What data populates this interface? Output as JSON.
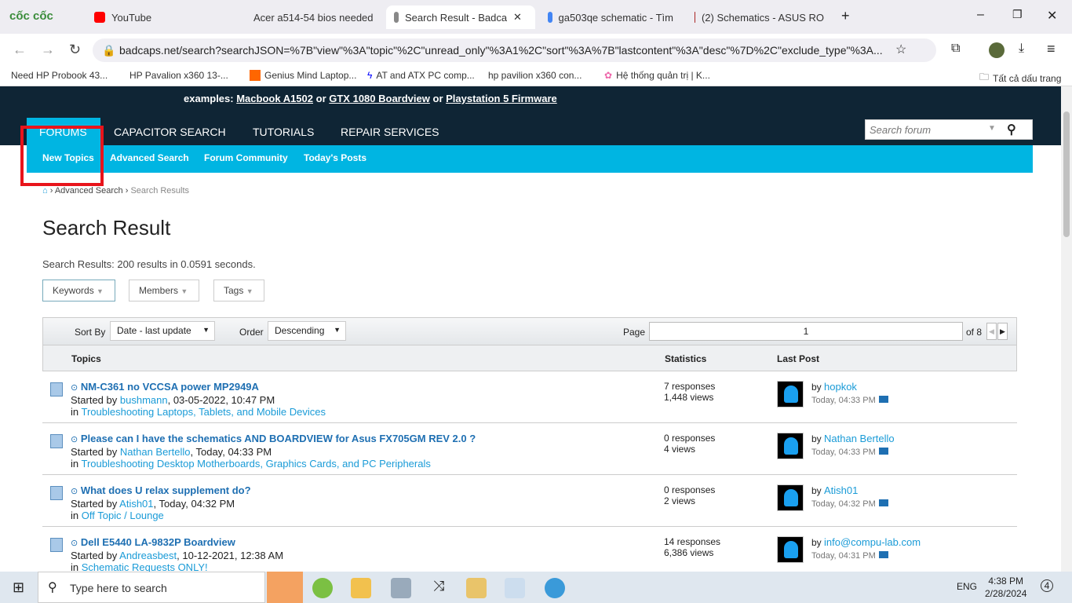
{
  "browser": {
    "brand": "cốc cốc",
    "tabs": [
      {
        "label": "YouTube"
      },
      {
        "label": "Acer a514-54 bios needed"
      },
      {
        "label": "Search Result - Badcaps"
      },
      {
        "label": "ga503qe schematic - Tìm"
      },
      {
        "label": "(2) Schematics - ASUS RO"
      }
    ],
    "url": "badcaps.net/search?searchJSON=%7B\"view\"%3A\"topic\"%2C\"unread_only\"%3A1%2C\"sort\"%3A%7B\"lastcontent\"%3A\"desc\"%7D%2C\"exclude_type\"%3A...",
    "bookmarks": [
      "Need HP Probook 43...",
      "HP Pavalion x360 13-...",
      "Genius Mind Laptop...",
      "AT and ATX PC comp...",
      "hp pavilion x360 con...",
      "Hệ thống quản trị | K..."
    ],
    "all_bookmarks": "Tất cả dấu trang"
  },
  "header": {
    "examples_label": "examples:",
    "ex1": "Macbook A1502",
    "or1": "or",
    "ex2": "GTX 1080 Boardview",
    "or2": "or",
    "ex3": "Playstation 5 Firmware",
    "nav": [
      "FORUMS",
      "CAPACITOR SEARCH",
      "TUTORIALS",
      "REPAIR SERVICES"
    ],
    "search_placeholder": "Search forum",
    "subnav": [
      "New Topics",
      "Advanced Search",
      "Forum Community",
      "Today's Posts"
    ]
  },
  "breadcrumb": [
    "Advanced Search",
    "Search Results"
  ],
  "page_title": "Search Result",
  "summary": "Search Results: 200 results in 0.0591 seconds.",
  "filters": [
    "Keywords",
    "Members",
    "Tags"
  ],
  "toolbar": {
    "sort_label": "Sort By",
    "sort_value": "Date - last update",
    "order_label": "Order",
    "order_value": "Descending",
    "page_label": "Page",
    "page_value": "1",
    "of_label": "of 8"
  },
  "columns": [
    "Topics",
    "Statistics",
    "Last Post"
  ],
  "rows": [
    {
      "title": "NM-C361 no VCCSA power MP2949A",
      "started": "Started by ",
      "author": "bushmann",
      "date": ", 03-05-2022, 10:47 PM",
      "in": "in ",
      "forum": "Troubleshooting Laptops, Tablets, and Mobile Devices",
      "responses": "7 responses",
      "views": "1,448 views",
      "by": "by ",
      "last_user": "hopkok",
      "last_time": "Today, 04:33 PM"
    },
    {
      "title": "Please can I have the schematics AND BOARDVIEW for Asus FX705GM REV 2.0 ?",
      "started": "Started by ",
      "author": "Nathan Bertello",
      "date": ", Today, 04:33 PM",
      "in": "in ",
      "forum": "Troubleshooting Desktop Motherboards, Graphics Cards, and PC Peripherals",
      "responses": "0 responses",
      "views": "4 views",
      "by": "by ",
      "last_user": "Nathan Bertello",
      "last_time": "Today, 04:33 PM"
    },
    {
      "title": "What does U relax supplement do?",
      "started": "Started by ",
      "author": "Atish01",
      "date": ", Today, 04:32 PM",
      "in": "in ",
      "forum": "Off Topic / Lounge",
      "responses": "0 responses",
      "views": "2 views",
      "by": "by ",
      "last_user": "Atish01",
      "last_time": "Today, 04:32 PM"
    },
    {
      "title": "Dell E5440 LA-9832P Boardview",
      "started": "Started by ",
      "author": "Andreasbest",
      "date": ", 10-12-2021, 12:38 AM",
      "in": "in ",
      "forum": "Schematic Requests ONLY!",
      "responses": "14 responses",
      "views": "6,386 views",
      "by": "by ",
      "last_user": "info@compu-lab.com",
      "last_time": "Today, 04:31 PM"
    }
  ],
  "taskbar": {
    "search_placeholder": "Type here to search",
    "lang": "ENG",
    "time": "4:38 PM",
    "date": "2/28/2024",
    "notifications": "4"
  }
}
